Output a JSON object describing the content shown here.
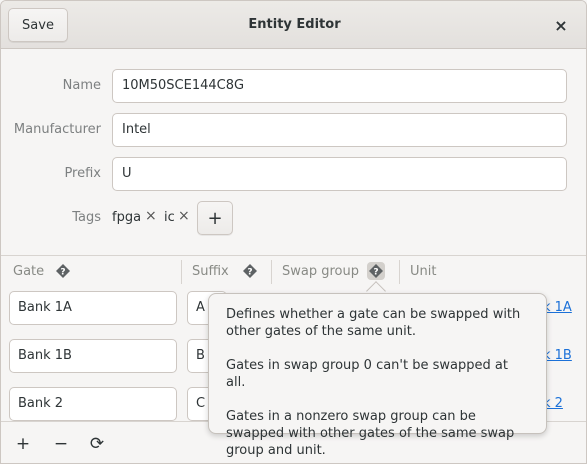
{
  "window": {
    "title": "Entity Editor",
    "save_label": "Save",
    "close_icon": "×"
  },
  "form": {
    "name_label": "Name",
    "name_value": "10M50SCE144C8G",
    "manufacturer_label": "Manufacturer",
    "manufacturer_value": "Intel",
    "prefix_label": "Prefix",
    "prefix_value": "U",
    "tags_label": "Tags",
    "tags": [
      "fpga",
      "ic"
    ],
    "tag_remove_icon": "×",
    "add_tag_icon": "+"
  },
  "table": {
    "columns": [
      "Gate",
      "Suffix",
      "Swap group",
      "Unit"
    ],
    "rows": [
      {
        "gate": "Bank 1A",
        "suffix": "A",
        "unit": "k 1A"
      },
      {
        "gate": "Bank 1B",
        "suffix": "B",
        "unit": "k 1B"
      },
      {
        "gate": "Bank 2",
        "suffix": "C",
        "unit": "k 2"
      }
    ]
  },
  "popover": {
    "paragraphs": [
      "Defines whether a gate can be swapped with other gates of the same unit.",
      "Gates in swap group 0 can't be swapped at all.",
      "Gates in a nonzero swap group can be swapped with other gates of the same swap group and unit."
    ]
  },
  "toolbar": {
    "add_icon": "+",
    "remove_icon": "−",
    "refresh_icon": "⟳"
  }
}
